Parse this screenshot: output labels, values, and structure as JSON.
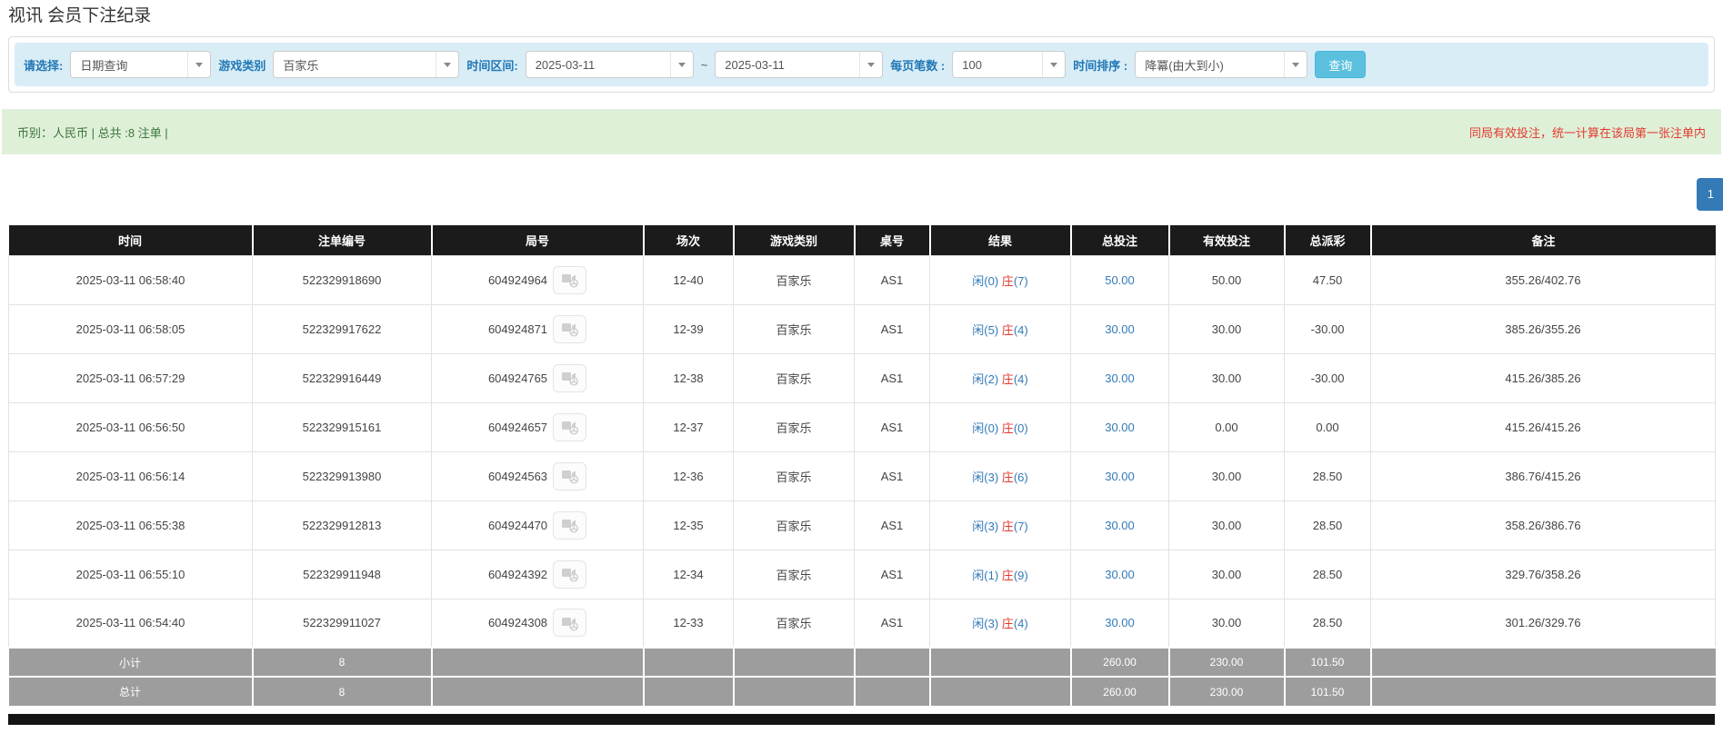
{
  "page": {
    "title": "视讯 会员下注纪录"
  },
  "filters": {
    "select_label": "请选择:",
    "select_value": "日期查询",
    "game_label": "游戏类别",
    "game_value": "百家乐",
    "range_label": "时间区间:",
    "date_from": "2025-03-11",
    "range_sep": "~",
    "date_to": "2025-03-11",
    "per_page_label": "每页笔数 :",
    "per_page_value": "100",
    "sort_label": "时间排序 :",
    "sort_value": "降冪(由大到小)",
    "query_button": "查询"
  },
  "summary": {
    "left_text": "币别：人民币 | 总共 :8 注单 |",
    "right_note": "同局有效投注，统一计算在该局第一张注单内"
  },
  "pagination": {
    "current": "1"
  },
  "colors": {
    "accent_blue": "#337ab7",
    "filter_bar_bg": "#d9edf7",
    "label_blue": "#2178b5",
    "query_button_bg": "#5bc0de",
    "alert_bg": "#dff0d8",
    "alert_text_green": "#3c763d",
    "note_red": "#e4392f",
    "header_bg": "#1b1b1b",
    "footer_bg": "#9d9d9d"
  },
  "icons": {
    "video_replay": "video-replay-icon",
    "dropdown_caret": "chevron-down-icon"
  },
  "table": {
    "headers": [
      "时间",
      "注单编号",
      "局号",
      "场次",
      "游戏类别",
      "桌号",
      "结果",
      "总投注",
      "有效投注",
      "总派彩",
      "备注"
    ],
    "rows": [
      {
        "time": "2025-03-11 06:58:40",
        "bet_no": "522329918690",
        "round_no": "604924964",
        "session": "12-40",
        "game": "百家乐",
        "table_no": "AS1",
        "result_player": "闲(0)",
        "result_banker": "庄",
        "result_banker_count": "(7)",
        "total_bet": "50.00",
        "valid_bet": "50.00",
        "payout": "47.50",
        "note": "355.26/402.76"
      },
      {
        "time": "2025-03-11 06:58:05",
        "bet_no": "522329917622",
        "round_no": "604924871",
        "session": "12-39",
        "game": "百家乐",
        "table_no": "AS1",
        "result_player": "闲(5)",
        "result_banker": "庄",
        "result_banker_count": "(4)",
        "total_bet": "30.00",
        "valid_bet": "30.00",
        "payout": "-30.00",
        "note": "385.26/355.26"
      },
      {
        "time": "2025-03-11 06:57:29",
        "bet_no": "522329916449",
        "round_no": "604924765",
        "session": "12-38",
        "game": "百家乐",
        "table_no": "AS1",
        "result_player": "闲(2)",
        "result_banker": "庄",
        "result_banker_count": "(4)",
        "total_bet": "30.00",
        "valid_bet": "30.00",
        "payout": "-30.00",
        "note": "415.26/385.26"
      },
      {
        "time": "2025-03-11 06:56:50",
        "bet_no": "522329915161",
        "round_no": "604924657",
        "session": "12-37",
        "game": "百家乐",
        "table_no": "AS1",
        "result_player": "闲(0)",
        "result_banker": "庄",
        "result_banker_count": "(0)",
        "total_bet": "30.00",
        "valid_bet": "0.00",
        "payout": "0.00",
        "note": "415.26/415.26"
      },
      {
        "time": "2025-03-11 06:56:14",
        "bet_no": "522329913980",
        "round_no": "604924563",
        "session": "12-36",
        "game": "百家乐",
        "table_no": "AS1",
        "result_player": "闲(3)",
        "result_banker": "庄",
        "result_banker_count": "(6)",
        "total_bet": "30.00",
        "valid_bet": "30.00",
        "payout": "28.50",
        "note": "386.76/415.26"
      },
      {
        "time": "2025-03-11 06:55:38",
        "bet_no": "522329912813",
        "round_no": "604924470",
        "session": "12-35",
        "game": "百家乐",
        "table_no": "AS1",
        "result_player": "闲(3)",
        "result_banker": "庄",
        "result_banker_count": "(7)",
        "total_bet": "30.00",
        "valid_bet": "30.00",
        "payout": "28.50",
        "note": "358.26/386.76"
      },
      {
        "time": "2025-03-11 06:55:10",
        "bet_no": "522329911948",
        "round_no": "604924392",
        "session": "12-34",
        "game": "百家乐",
        "table_no": "AS1",
        "result_player": "闲(1)",
        "result_banker": "庄",
        "result_banker_count": "(9)",
        "total_bet": "30.00",
        "valid_bet": "30.00",
        "payout": "28.50",
        "note": "329.76/358.26"
      },
      {
        "time": "2025-03-11 06:54:40",
        "bet_no": "522329911027",
        "round_no": "604924308",
        "session": "12-33",
        "game": "百家乐",
        "table_no": "AS1",
        "result_player": "闲(3)",
        "result_banker": "庄",
        "result_banker_count": "(4)",
        "total_bet": "30.00",
        "valid_bet": "30.00",
        "payout": "28.50",
        "note": "301.26/329.76"
      }
    ],
    "subtotal": {
      "label": "小计",
      "count": "8",
      "total_bet": "260.00",
      "valid_bet": "230.00",
      "payout": "101.50"
    },
    "total": {
      "label": "总计",
      "count": "8",
      "total_bet": "260.00",
      "valid_bet": "230.00",
      "payout": "101.50"
    }
  }
}
